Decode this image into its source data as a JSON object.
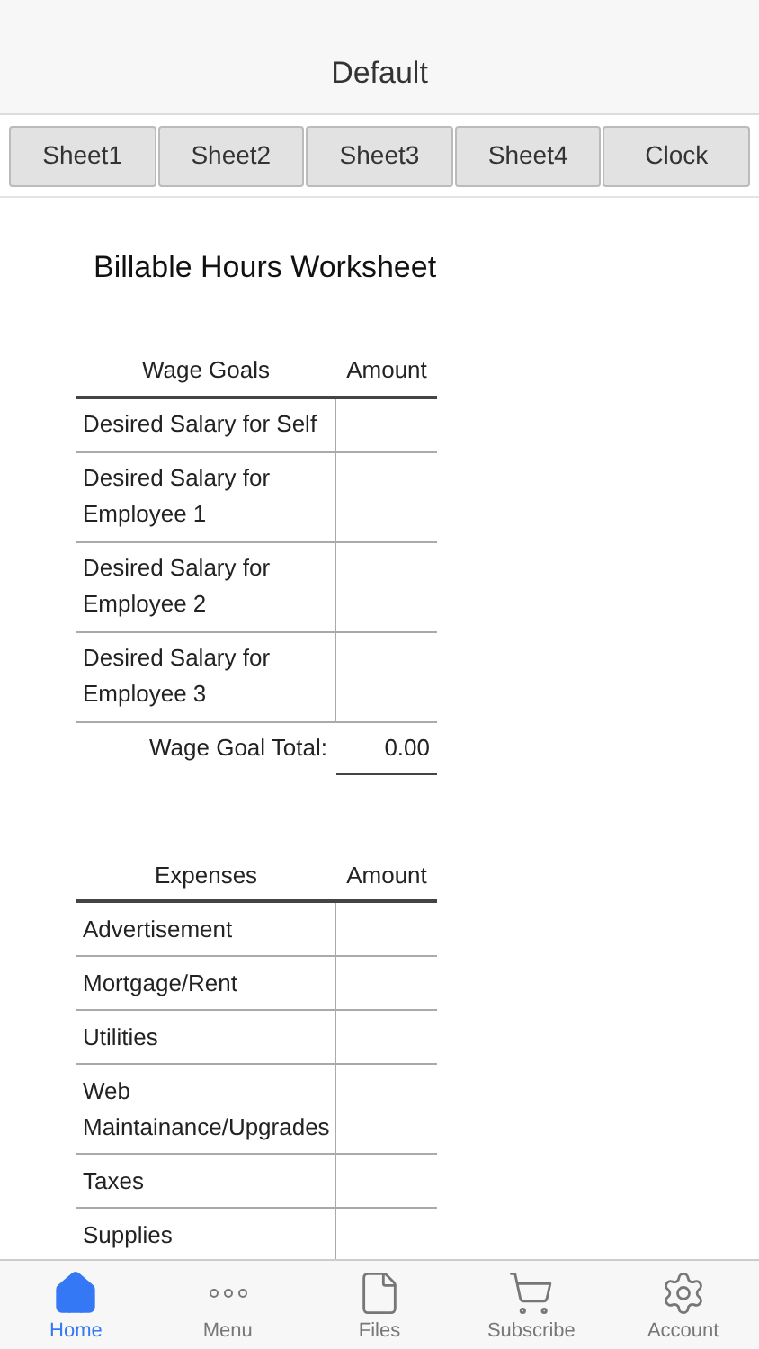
{
  "header": {
    "title": "Default"
  },
  "sheet_tabs": [
    "Sheet1",
    "Sheet2",
    "Sheet3",
    "Sheet4",
    "Clock"
  ],
  "worksheet": {
    "title": "Billable Hours Worksheet",
    "wage_goals": {
      "columns": [
        "Wage Goals",
        "Amount"
      ],
      "rows": [
        {
          "label": "Desired Salary for Self"
        },
        {
          "label": "Desired Salary for Employee 1"
        },
        {
          "label": "Desired Salary for Employee 2"
        },
        {
          "label": "Desired Salary for Employee 3"
        }
      ],
      "total_label": "Wage Goal Total:",
      "total_value": "0.00"
    },
    "expenses": {
      "columns": [
        "Expenses",
        "Amount"
      ],
      "rows": [
        {
          "label": "Advertisement"
        },
        {
          "label": "Mortgage/Rent"
        },
        {
          "label": "Utilities"
        },
        {
          "label": "Web Maintainance/Upgrades"
        },
        {
          "label": "Taxes"
        },
        {
          "label": "Supplies"
        }
      ]
    }
  },
  "tab_bar": [
    {
      "label": "Home",
      "kind": "home",
      "selected": true
    },
    {
      "label": "Menu",
      "kind": "menu",
      "selected": false
    },
    {
      "label": "Files",
      "kind": "files",
      "selected": false
    },
    {
      "label": "Subscribe",
      "kind": "subscribe",
      "selected": false
    },
    {
      "label": "Account",
      "kind": "account",
      "selected": false
    }
  ]
}
